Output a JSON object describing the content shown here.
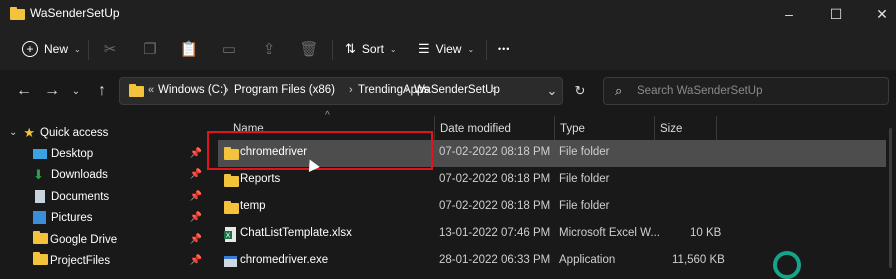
{
  "window": {
    "title": "WaSenderSetUp",
    "minimize": "–",
    "maximize": "☐",
    "close": "✕"
  },
  "toolbar": {
    "new_label": "New",
    "sort_label": "Sort",
    "view_label": "View",
    "more_label": "•••"
  },
  "address_bar": {
    "prefix": "«",
    "crumbs": [
      "Windows (C:)",
      "Program Files (x86)",
      "TrendingApps",
      "WaSenderSetUp"
    ]
  },
  "search": {
    "placeholder": "Search WaSenderSetUp"
  },
  "sidebar": {
    "quick_access": "Quick access",
    "items": [
      {
        "label": "Desktop",
        "icon": "desktop-icon",
        "pinned": true
      },
      {
        "label": "Downloads",
        "icon": "downloads-icon",
        "pinned": true
      },
      {
        "label": "Documents",
        "icon": "documents-icon",
        "pinned": true
      },
      {
        "label": "Pictures",
        "icon": "pictures-icon",
        "pinned": true
      },
      {
        "label": "Google Drive",
        "icon": "folder-icon",
        "pinned": true
      },
      {
        "label": "ProjectFiles",
        "icon": "folder-icon",
        "pinned": true
      }
    ]
  },
  "columns": {
    "name": "Name",
    "date_modified": "Date modified",
    "type": "Type",
    "size": "Size"
  },
  "files": [
    {
      "name": "chromedriver",
      "date": "07-02-2022 08:18 PM",
      "type": "File folder",
      "size": "",
      "icon": "folder-icon",
      "selected": true
    },
    {
      "name": "Reports",
      "date": "07-02-2022 08:18 PM",
      "type": "File folder",
      "size": "",
      "icon": "folder-icon",
      "selected": false
    },
    {
      "name": "temp",
      "date": "07-02-2022 08:18 PM",
      "type": "File folder",
      "size": "",
      "icon": "folder-icon",
      "selected": false
    },
    {
      "name": "ChatListTemplate.xlsx",
      "date": "13-01-2022 07:46 PM",
      "type": "Microsoft Excel W...",
      "size": "10 KB",
      "icon": "excel-file-icon",
      "selected": false
    },
    {
      "name": "chromedriver.exe",
      "date": "28-01-2022 06:33 PM",
      "type": "Application",
      "size": "11,560 KB",
      "icon": "exe-file-icon",
      "selected": false
    }
  ],
  "colors": {
    "folder": "#f3c33b",
    "highlight": "#e0141c",
    "selection": "#4d4d4d",
    "accent": "#15a38a"
  }
}
